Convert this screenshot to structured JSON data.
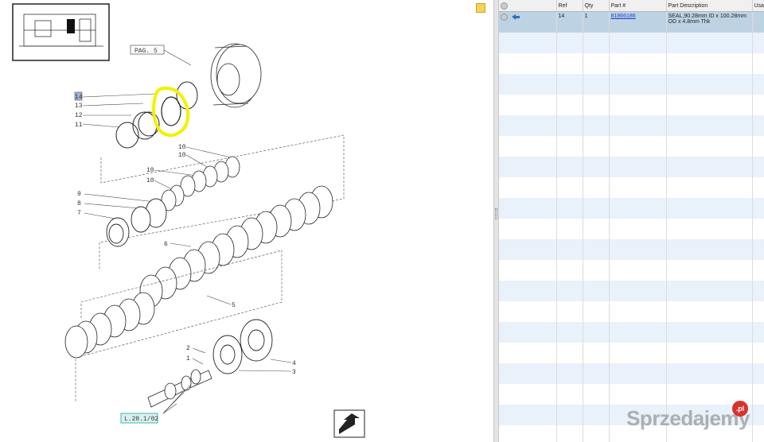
{
  "diagram": {
    "page_ref_label": "PAG. 5",
    "page_link_label": "L.28.1/02",
    "callouts": [
      "14",
      "13",
      "12",
      "11",
      "10",
      "10",
      "10",
      "10",
      "9",
      "8",
      "7",
      "6",
      "5",
      "4",
      "3",
      "2",
      "1"
    ],
    "highlight_color": "#f5f000"
  },
  "parts_table": {
    "columns": [
      "",
      "Ref",
      "Qty",
      "Part #",
      "Part Description",
      "Usa"
    ],
    "rows": [
      {
        "ref": "14",
        "qty": "1",
        "part_number": "81866186",
        "description_line1": "SEAL,90.28mm ID x 100.28mm",
        "description_line2": "OD x 4.8mm Thk"
      }
    ],
    "selected_row_color": "#bdd3e4",
    "alt_row_color": "#e9f1fa"
  },
  "watermark": {
    "text": "Sprzedajemy",
    "badge": ".pl"
  }
}
